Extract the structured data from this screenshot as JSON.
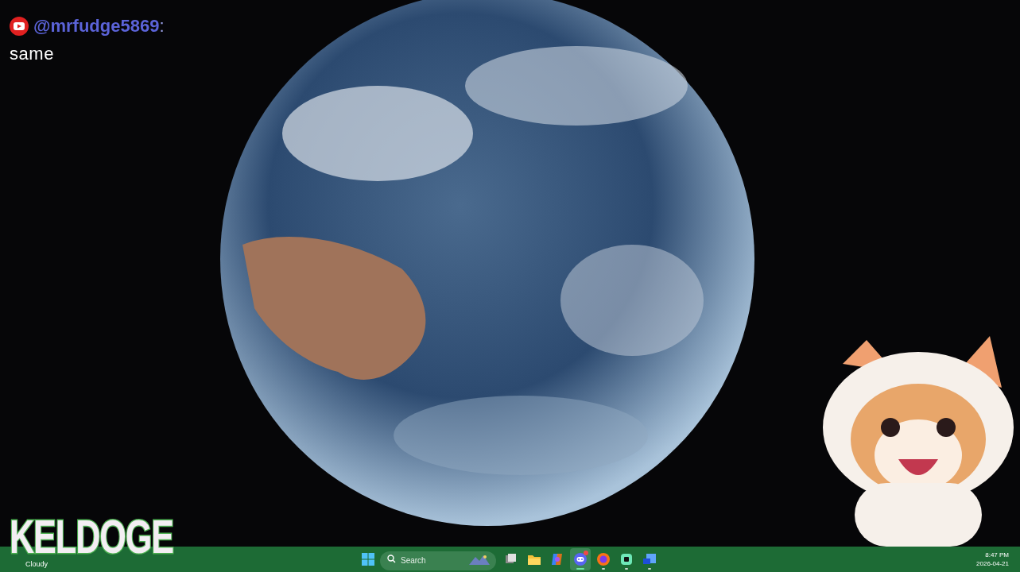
{
  "chat": {
    "username": "@mrfudge5869",
    "separator": ":",
    "message": "same"
  },
  "logo": {
    "text": "KELDOGE"
  },
  "taskbar": {
    "weather": "Cloudy",
    "search": {
      "placeholder": "Search"
    },
    "apps": [
      {
        "kind": "task-view",
        "running": false,
        "selected": false,
        "badge": false
      },
      {
        "kind": "folder",
        "running": false,
        "selected": false,
        "badge": false
      },
      {
        "kind": "copilot",
        "running": false,
        "selected": false,
        "badge": false
      },
      {
        "kind": "chat",
        "running": true,
        "selected": true,
        "badge": true
      },
      {
        "kind": "browser",
        "running": true,
        "selected": false,
        "badge": false
      },
      {
        "kind": "terminal",
        "running": true,
        "selected": false,
        "badge": false
      },
      {
        "kind": "mail",
        "running": true,
        "selected": false,
        "badge": false
      }
    ],
    "time": "8:47 PM",
    "date": "2026-04-21"
  }
}
